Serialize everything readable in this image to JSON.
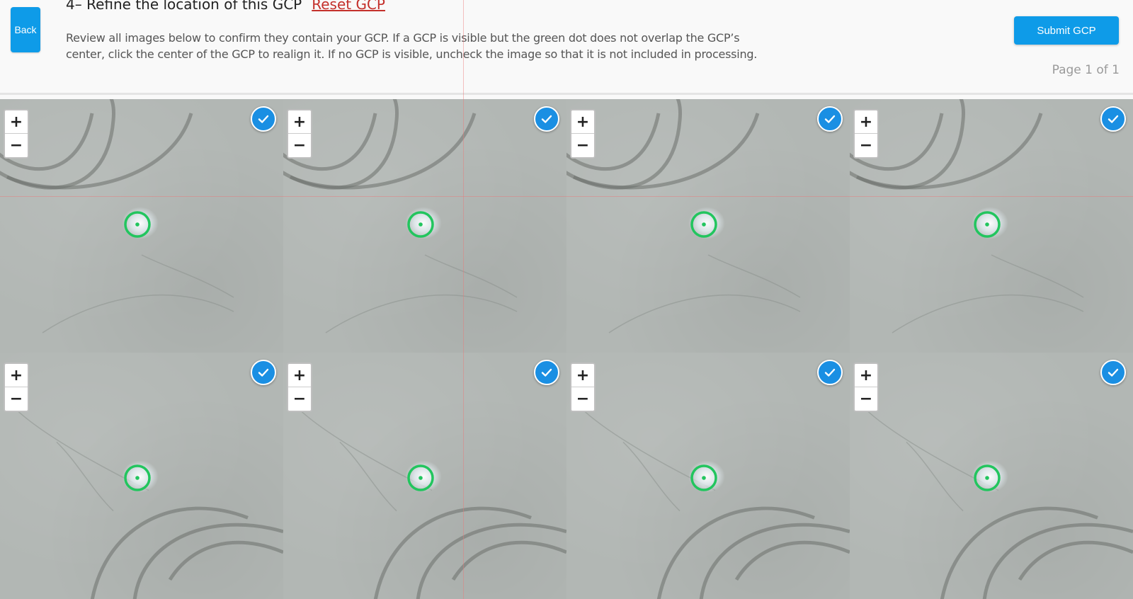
{
  "header": {
    "back_label": "Back",
    "title": "4– Refine the location of this GCP",
    "reset_label": "Reset GCP",
    "instructions": "Review all images below to confirm they contain your GCP. If a GCP is visible but the green dot does not overlap the GCP’s center, click the center of the GCP to realign it. If no GCP is visible, uncheck the image so that it is not included in processing.",
    "submit_label": "Submit GCP",
    "page_indicator": "Page 1 of 1"
  },
  "colors": {
    "accent_blue": "#0e9be8",
    "check_blue": "#1a8fe3",
    "reset_red": "#c4302b",
    "gcp_green": "#22c55e"
  },
  "zoom_controls": {
    "zoom_in": "+",
    "zoom_out": "−"
  },
  "icons": {
    "check": "check-icon",
    "gcp": "gcp-target-icon"
  },
  "images": [
    {
      "checked": true,
      "tire_marks": "top"
    },
    {
      "checked": true,
      "tire_marks": "top"
    },
    {
      "checked": true,
      "tire_marks": "top"
    },
    {
      "checked": true,
      "tire_marks": "top"
    },
    {
      "checked": true,
      "tire_marks": "bottom"
    },
    {
      "checked": true,
      "tire_marks": "bottom"
    },
    {
      "checked": true,
      "tire_marks": "bottom"
    },
    {
      "checked": true,
      "tire_marks": "bottom"
    }
  ]
}
